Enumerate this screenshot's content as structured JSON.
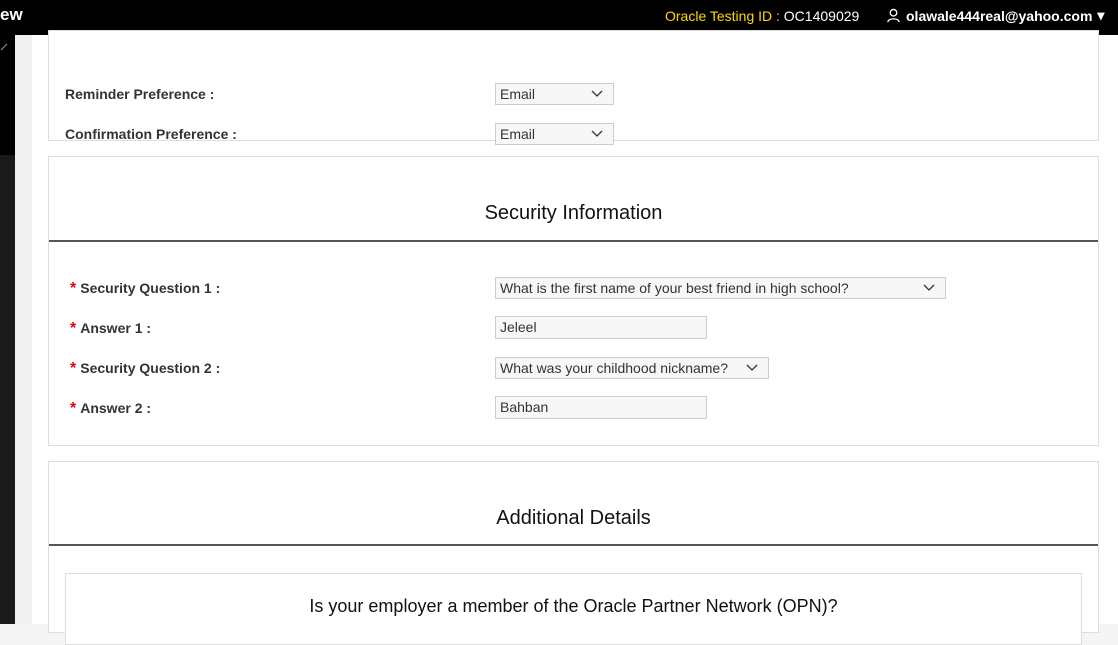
{
  "header": {
    "brand_fragment": "ew",
    "testing_id_label": "Oracle Testing ID : ",
    "testing_id_value": "OC1409029",
    "user_email": "olawale444real@yahoo.com",
    "user_menu_caret": "▾"
  },
  "preferences": {
    "reminder_label": "Reminder Preference :",
    "reminder_value": "Email",
    "confirmation_label": "Confirmation Preference :",
    "confirmation_value": "Email"
  },
  "security": {
    "title": "Security Information",
    "required_mark": "*",
    "q1_label": "Security Question 1 :",
    "q1_value": "What is the first name of your best friend in high school?",
    "a1_label": "Answer 1 :",
    "a1_value": "Jeleel",
    "q2_label": "Security Question 2 :",
    "q2_value": "What was your childhood nickname?",
    "a2_label": "Answer 2 :",
    "a2_value": "Bahban"
  },
  "additional": {
    "title": "Additional Details",
    "opn_question": "Is your employer a member of the Oracle Partner Network (OPN)?"
  }
}
